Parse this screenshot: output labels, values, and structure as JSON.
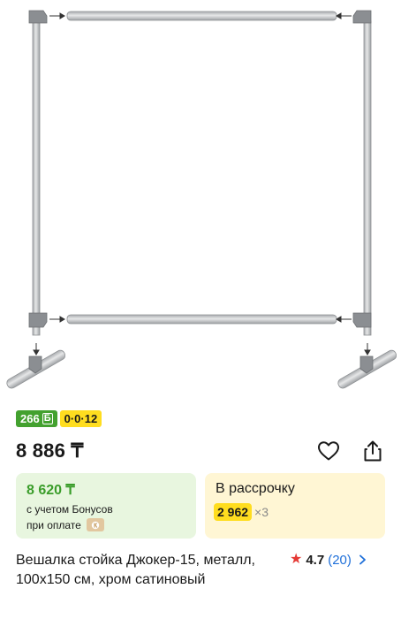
{
  "badges": {
    "bonus": "266",
    "bonus_icon": "bonus-b-icon",
    "installment": "0·0·12"
  },
  "price": "8 886 ₸",
  "actions": {
    "favorite_icon": "heart-icon",
    "share_icon": "share-icon"
  },
  "bonus_card": {
    "price": "8 620 ₸",
    "note_line1": "с учетом Бонусов",
    "note_line2": "при оплате",
    "pay_icon": "kaspi-pay-icon"
  },
  "installment_card": {
    "label": "В рассрочку",
    "amount": "2 962",
    "months": "×3"
  },
  "product": {
    "title": "Вешалка стойка Джокер-15, металл, 100x150 см, хром сатиновый",
    "rating": "4.7",
    "reviews": "(20)"
  },
  "colors": {
    "green": "#43a12f",
    "yellow": "#ffdd1f",
    "star_red": "#e53935",
    "link_blue": "#1e6fd9"
  }
}
